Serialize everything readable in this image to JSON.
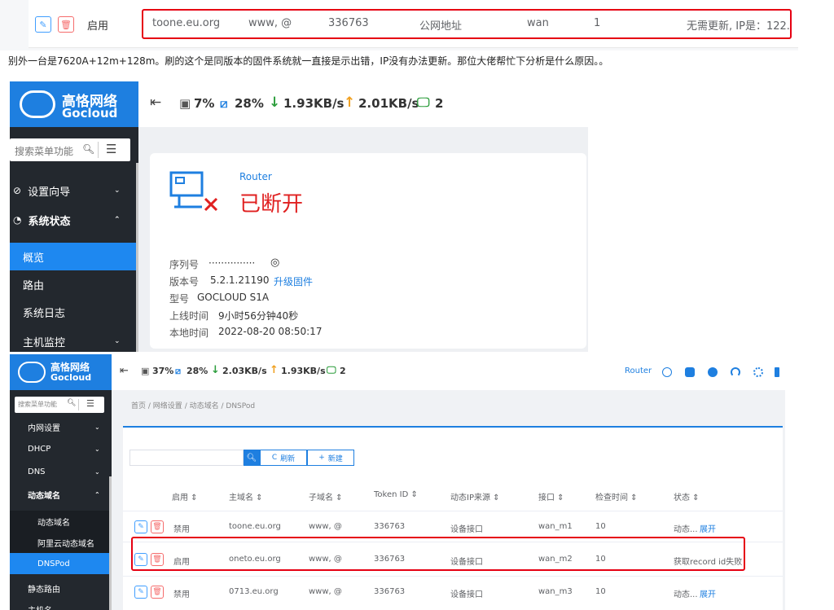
{
  "top_row": {
    "status": "启用",
    "domain": "toone.eu.org",
    "subdomain": "www, @",
    "token": "336763",
    "ip_source": "公网地址",
    "iface": "wan",
    "interval": "1",
    "state": "无需更新, IP是：122."
  },
  "post_text": "别外一台是7620A+12m+128m。刷的这个是同版本的固件系统就一直接是示出错，IP没有办法更新。那位大佬帮忙下分析是什么原因。。",
  "brand": {
    "name_cn": "高恪网络",
    "name_en": "Gocloud"
  },
  "screen1": {
    "stats": {
      "cpu": "7%",
      "mem": "28%",
      "down": "1.93KB/s",
      "up": "2.01KB/s",
      "clients": "2"
    },
    "search_placeholder": "搜索菜单功能",
    "menu": {
      "wizard": "设置向导",
      "status": "系统状态",
      "overview": "概览",
      "route": "路由",
      "syslog": "系统日志",
      "monitor": "主机监控"
    },
    "router_label": "Router",
    "router_state": "已断开",
    "serial_label": "序列号",
    "serial_value": "···············",
    "version_label": "版本号",
    "version_value": "5.2.1.21190",
    "upgrade_link": "升级固件",
    "model_label": "型号",
    "model_value": "GOCLOUD S1A",
    "uptime_label": "上线时间",
    "uptime_value": "9小时56分钟40秒",
    "time_label": "本地时间",
    "time_value": "2022-08-20 08:50:17"
  },
  "screen2": {
    "stats": {
      "cpu": "37%",
      "mem": "28%",
      "down": "2.03KB/s",
      "up": "1.93KB/s",
      "clients": "2"
    },
    "router_label": "Router",
    "search_placeholder": "搜索菜单功能",
    "menu": {
      "lan": "内网设置",
      "dhcp": "DHCP",
      "dns": "DNS",
      "ddns": "动态域名",
      "ddns_sub": "动态域名",
      "aliyun": "阿里云动态域名",
      "dnspod": "DNSPod",
      "static_route": "静态路由",
      "more": "主机名"
    },
    "breadcrumb": {
      "home": "首页",
      "net": "网络设置",
      "ddns": "动态域名",
      "page": "DNSPod"
    },
    "toolbar": {
      "refresh": "刷新",
      "add": "新建"
    },
    "columns": {
      "enable": "启用 ⇕",
      "domain": "主域名 ⇕",
      "subdomain": "子域名 ⇕",
      "token": "Token ID ⇕",
      "ip_source": "动态IP来源 ⇕",
      "iface": "接口 ⇕",
      "interval": "检查时间 ⇕",
      "state": "状态 ⇕"
    },
    "rows": [
      {
        "enable": "禁用",
        "domain": "toone.eu.org",
        "subdomain": "www, @",
        "token": "336763",
        "ip_source": "设备接口",
        "iface": "wan_m1",
        "interval": "10",
        "state": "动态...",
        "expand": "展开"
      },
      {
        "enable": "启用",
        "domain": "oneto.eu.org",
        "subdomain": "www, @",
        "token": "336763",
        "ip_source": "设备接口",
        "iface": "wan_m2",
        "interval": "10",
        "state": "获取record id失败",
        "expand": ""
      },
      {
        "enable": "禁用",
        "domain": "0713.eu.org",
        "subdomain": "www, @",
        "token": "336763",
        "ip_source": "设备接口",
        "iface": "wan_m3",
        "interval": "10",
        "state": "动态...",
        "expand": "展开"
      }
    ]
  }
}
